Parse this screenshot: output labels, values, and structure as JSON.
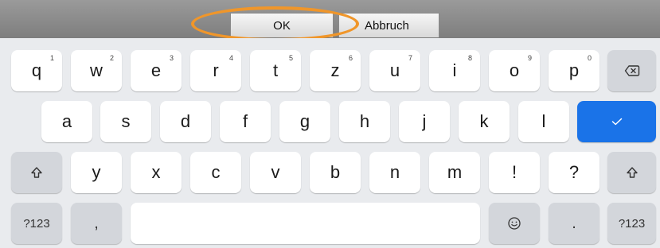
{
  "topbar": {
    "ok_label": "OK",
    "cancel_label": "Abbruch"
  },
  "keyboard": {
    "row1": [
      {
        "label": "q",
        "hint": "1"
      },
      {
        "label": "w",
        "hint": "2"
      },
      {
        "label": "e",
        "hint": "3"
      },
      {
        "label": "r",
        "hint": "4"
      },
      {
        "label": "t",
        "hint": "5"
      },
      {
        "label": "z",
        "hint": "6"
      },
      {
        "label": "u",
        "hint": "7"
      },
      {
        "label": "i",
        "hint": "8"
      },
      {
        "label": "o",
        "hint": "9"
      },
      {
        "label": "p",
        "hint": "0"
      }
    ],
    "row2": [
      "a",
      "s",
      "d",
      "f",
      "g",
      "h",
      "j",
      "k",
      "l"
    ],
    "row3": [
      "y",
      "x",
      "c",
      "v",
      "b",
      "n",
      "m",
      "!",
      "?"
    ],
    "row4": {
      "symbols_left": "?123",
      "comma": ",",
      "period": ".",
      "symbols_right": "?123"
    },
    "icons": {
      "backspace": "backspace-icon",
      "enter": "checkmark-icon",
      "shift": "shift-icon",
      "emoji": "emoji-icon"
    },
    "colors": {
      "enter_key": "#1a73e8",
      "highlight_ring": "#f0962a"
    }
  }
}
